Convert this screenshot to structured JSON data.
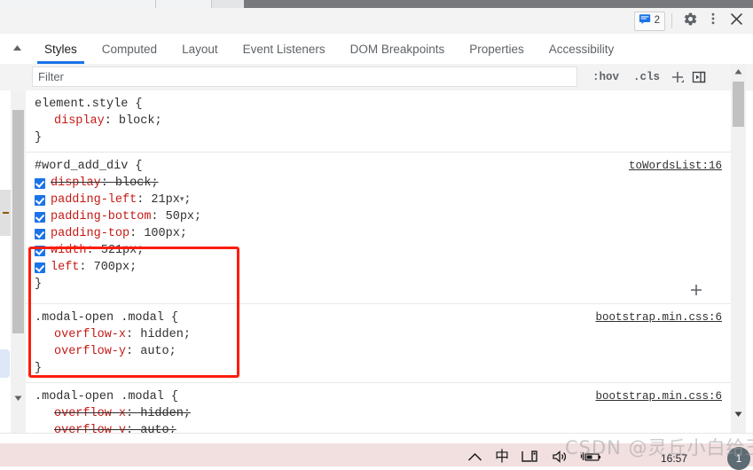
{
  "toolbar": {
    "messages_icon": "message-icon",
    "messages_count": "2",
    "settings_icon": "gear-icon",
    "more_icon": "kebab-menu-icon",
    "close_icon": "close-icon"
  },
  "tabs": [
    {
      "label": "Styles",
      "active": true
    },
    {
      "label": "Computed",
      "active": false
    },
    {
      "label": "Layout",
      "active": false
    },
    {
      "label": "Event Listeners",
      "active": false
    },
    {
      "label": "DOM Breakpoints",
      "active": false
    },
    {
      "label": "Properties",
      "active": false
    },
    {
      "label": "Accessibility",
      "active": false
    }
  ],
  "filter": {
    "placeholder": "Filter",
    "value": "",
    "hov_label": ":hov",
    "cls_label": ".cls",
    "new_rule_icon": "plus-icon",
    "toggle_sidebar_icon": "panel-toggle-icon"
  },
  "rules": [
    {
      "selector": "element.style {",
      "close": "}",
      "source": "",
      "declarations": [
        {
          "property": "display",
          "value": "block",
          "checkbox": false,
          "disabled": false,
          "dropdown": false
        }
      ]
    },
    {
      "selector": "#word_add_div {",
      "close": "}",
      "source": "toWordsList:16",
      "declarations": [
        {
          "property": "display",
          "value": "block",
          "checkbox": true,
          "disabled": true,
          "dropdown": false
        },
        {
          "property": "padding-left",
          "value": "21px",
          "checkbox": true,
          "disabled": false,
          "dropdown": true
        },
        {
          "property": "padding-bottom",
          "value": "50px",
          "checkbox": true,
          "disabled": false,
          "dropdown": false
        },
        {
          "property": "padding-top",
          "value": "100px",
          "checkbox": true,
          "disabled": false,
          "dropdown": false
        },
        {
          "property": "width",
          "value": "521px",
          "checkbox": true,
          "disabled": false,
          "dropdown": false
        },
        {
          "property": "left",
          "value": "700px",
          "checkbox": true,
          "disabled": false,
          "dropdown": false
        }
      ]
    },
    {
      "selector": ".modal-open .modal {",
      "close": "}",
      "source": "bootstrap.min.css:6",
      "declarations": [
        {
          "property": "overflow-x",
          "value": "hidden",
          "checkbox": false,
          "disabled": false,
          "dropdown": false
        },
        {
          "property": "overflow-y",
          "value": "auto",
          "checkbox": false,
          "disabled": false,
          "dropdown": false
        }
      ]
    },
    {
      "selector": ".modal-open .modal {",
      "close": "}",
      "source": "bootstrap.min.css:6",
      "declarations": [
        {
          "property": "overflow-x",
          "value": "hidden",
          "checkbox": false,
          "disabled": true,
          "dropdown": false
        },
        {
          "property": "overflow-y",
          "value": "auto",
          "checkbox": false,
          "disabled": true,
          "dropdown": false
        }
      ]
    }
  ],
  "annotation": {
    "highlight_color": "#fc1d0c",
    "target_rule": "#word_add_div"
  },
  "taskbar": {
    "tray_icons": [
      "chevron-up-icon",
      "ime-icon",
      "display-icon",
      "volume-icon",
      "battery-charging-icon"
    ],
    "ime_label": "中",
    "clock": "16:57",
    "notification_count": "1"
  },
  "watermark": {
    "text": "CSDN @灵丘小白给王"
  },
  "accent": {
    "tab_underline": "#1a73e8",
    "property_text": "#c41a16",
    "checkbox": "#1a73e8"
  }
}
